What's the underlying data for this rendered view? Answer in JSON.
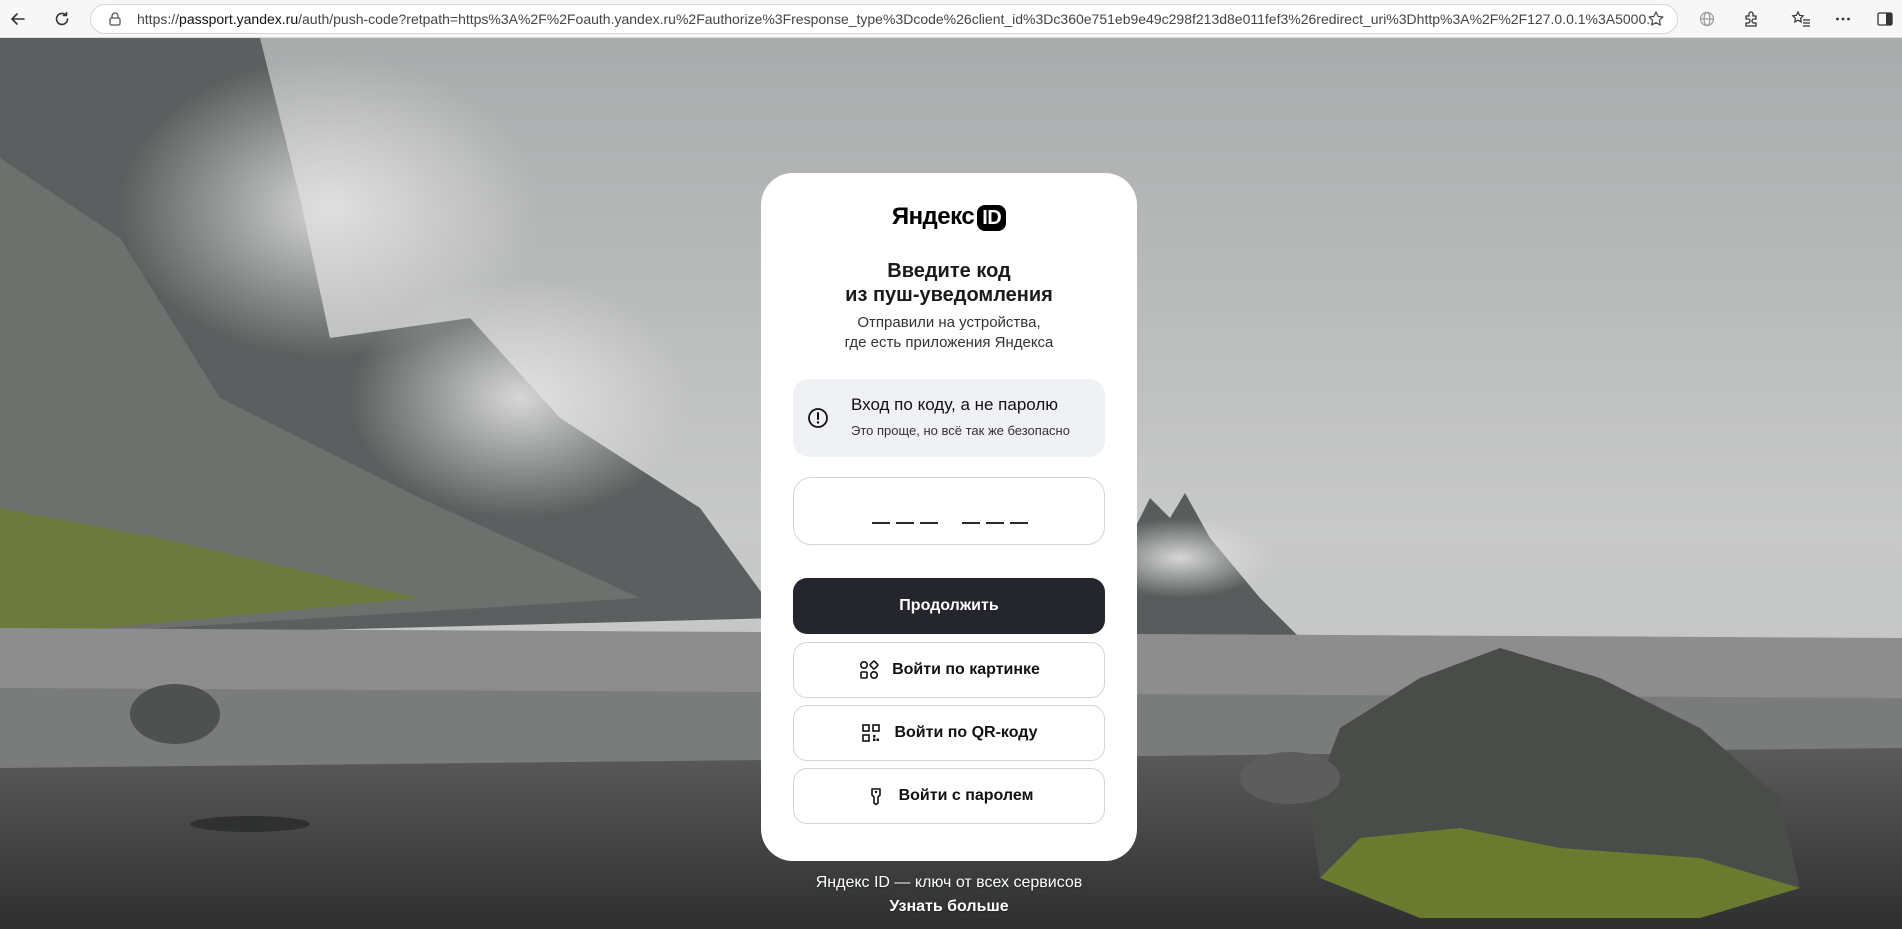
{
  "browser": {
    "url_host": "passport.yandex.ru",
    "url_path": "/auth/push-code?retpath=https%3A%2F%2Foauth.yandex.ru%2Fauthorize%3Fresponse_type%3Dcode%26client_id%3Dc360e751eb9e49c298f213d8e011fef3%26redirect_uri%3Dhttp%3A%2F%2F127.0.0.1%3A5000...",
    "url_scheme": "https://",
    "icons": [
      "back-icon",
      "reload-icon",
      "lock-icon",
      "star-icon",
      "globe-icon",
      "extensions-icon",
      "favorites-icon",
      "more-icon",
      "sidebar-icon"
    ]
  },
  "card": {
    "logo_text": "Яндекс",
    "logo_badge": "ID",
    "title_line1": "Введите код",
    "title_line2": "из пуш-уведомления",
    "subtitle_line1": "Отправили на устройства,",
    "subtitle_line2": "где есть приложения Яндекса",
    "notice_title": "Вход по коду, а не паролю",
    "notice_text": "Это проще, но всё так же безопасно",
    "notice_icon": "exclamation-circle-icon",
    "code_input_value": "",
    "continue_label": "Продолжить",
    "picture_login_label": "Войти по картинке",
    "qr_login_label": "Войти по QR-коду",
    "password_login_label": "Войти с паролем"
  },
  "footer": {
    "tagline": "Яндекс ID — ключ от всех сервисов",
    "learn_more": "Узнать больше"
  },
  "colors": {
    "primary_button": "#25252d",
    "notice_bg": "#f0f1f4",
    "card_bg": "#ffffff"
  }
}
